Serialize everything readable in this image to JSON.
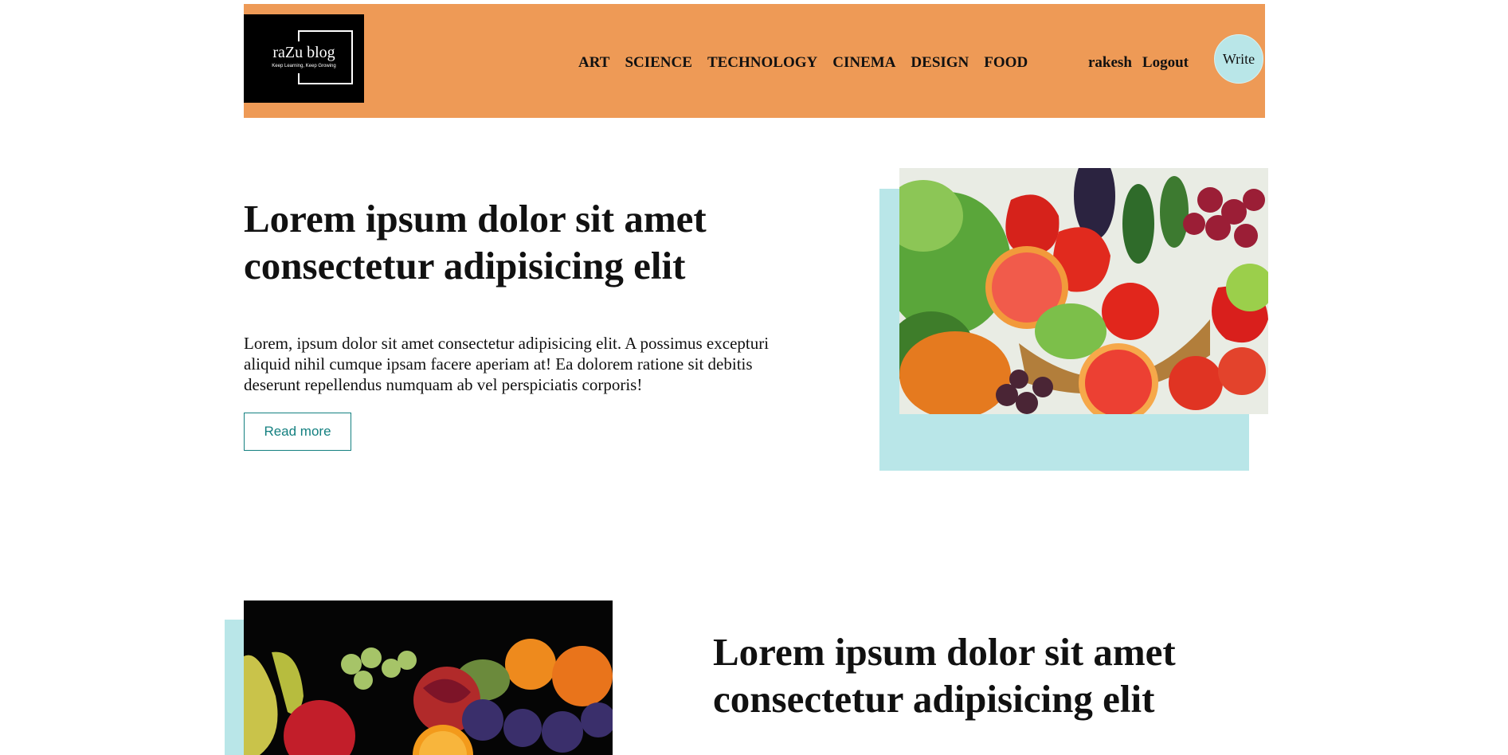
{
  "header": {
    "logo": {
      "title": "raZu blog",
      "tagline": "Keep Learning, Keep Growing"
    },
    "nav": [
      "ART",
      "SCIENCE",
      "TECHNOLOGY",
      "CINEMA",
      "DESIGN",
      "FOOD"
    ],
    "user": {
      "name": "rakesh",
      "logout_label": "Logout"
    },
    "write_label": "Write",
    "colors": {
      "bar": "#ee9a56",
      "write_button": "#b9e6e8"
    }
  },
  "posts": [
    {
      "title": "Lorem ipsum dolor sit amet consectetur adipisicing elit",
      "description": "Lorem, ipsum dolor sit amet consectetur adipisicing elit. A possimus excepturi aliquid nihil cumque ipsam facere aperiam at! Ea dolorem ratione sit debitis deserunt repellendus numquam ab vel perspiciatis corporis!",
      "read_more_label": "Read more",
      "image": "vegetables-and-fruits-photo"
    },
    {
      "title": "Lorem ipsum dolor sit amet consectetur adipisicing elit",
      "image": "fruits-on-dark-background-photo"
    }
  ],
  "colors": {
    "accent": "#148080",
    "image_backdrop": "#b9e6e8"
  }
}
